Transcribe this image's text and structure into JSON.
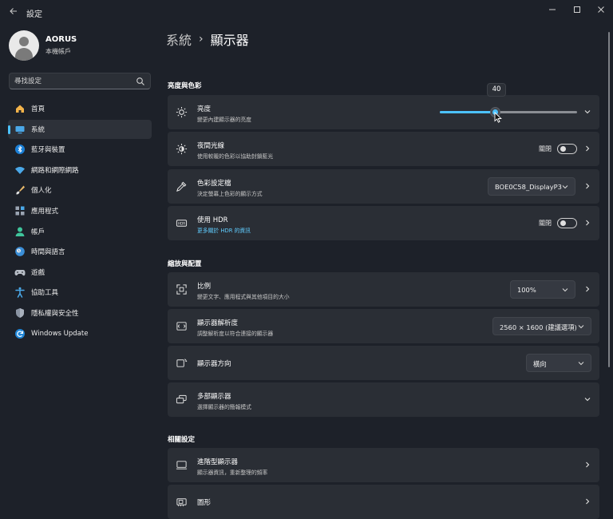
{
  "window": {
    "title": "設定",
    "colors": {
      "background": "#1d2129",
      "card": "#2a2e35",
      "accent": "#4cc2ff",
      "link": "#60cdff"
    }
  },
  "user": {
    "name": "AORUS",
    "account": "本機帳戶"
  },
  "search": {
    "placeholder": "尋找設定"
  },
  "nav": [
    {
      "label": "首頁",
      "icon": "home-icon"
    },
    {
      "label": "系統",
      "icon": "monitor-icon",
      "active": true
    },
    {
      "label": "藍牙與裝置",
      "icon": "bluetooth-icon"
    },
    {
      "label": "網路和網際網路",
      "icon": "wifi-icon"
    },
    {
      "label": "個人化",
      "icon": "brush-icon"
    },
    {
      "label": "應用程式",
      "icon": "apps-icon"
    },
    {
      "label": "帳戶",
      "icon": "person-icon"
    },
    {
      "label": "時間與語言",
      "icon": "globe-clock-icon"
    },
    {
      "label": "遊戲",
      "icon": "gamepad-icon"
    },
    {
      "label": "協助工具",
      "icon": "accessibility-icon"
    },
    {
      "label": "隱私權與安全性",
      "icon": "shield-icon"
    },
    {
      "label": "Windows Update",
      "icon": "update-icon"
    }
  ],
  "breadcrumb": {
    "parent": "系統",
    "separator": "›",
    "current": "顯示器"
  },
  "sections": {
    "brightness": "亮度與色彩",
    "scale": "縮放與配置",
    "related": "相關設定"
  },
  "brightness": {
    "title": "亮度",
    "subtitle": "變更內建顯示器的亮度",
    "value": 40,
    "value_label": "40"
  },
  "night_light": {
    "title": "夜間光線",
    "subtitle": "使用較暖的色彩以協助封鎖藍光",
    "state": "關閉"
  },
  "color_profile": {
    "title": "色彩設定檔",
    "subtitle": "決定螢幕上色彩的顯示方式",
    "value": "BOE0C58_DisplayP3"
  },
  "hdr": {
    "title": "使用 HDR",
    "link": "更多關於 HDR 的資訊",
    "state": "關閉"
  },
  "scale": {
    "title": "比例",
    "subtitle": "變更文字、應用程式與其他項目的大小",
    "value": "100%"
  },
  "resolution": {
    "title": "顯示器解析度",
    "subtitle": "調整解析度以符合連接的顯示器",
    "value": "2560 × 1600 (建議選項)"
  },
  "orientation": {
    "title": "顯示器方向",
    "value": "橫向"
  },
  "multi_display": {
    "title": "多部顯示器",
    "subtitle": "選擇顯示器的簡報模式"
  },
  "advanced_display": {
    "title": "進階型顯示器",
    "subtitle": "顯示器資訊，重新整理的頻率"
  },
  "graphics": {
    "title": "圖形"
  }
}
